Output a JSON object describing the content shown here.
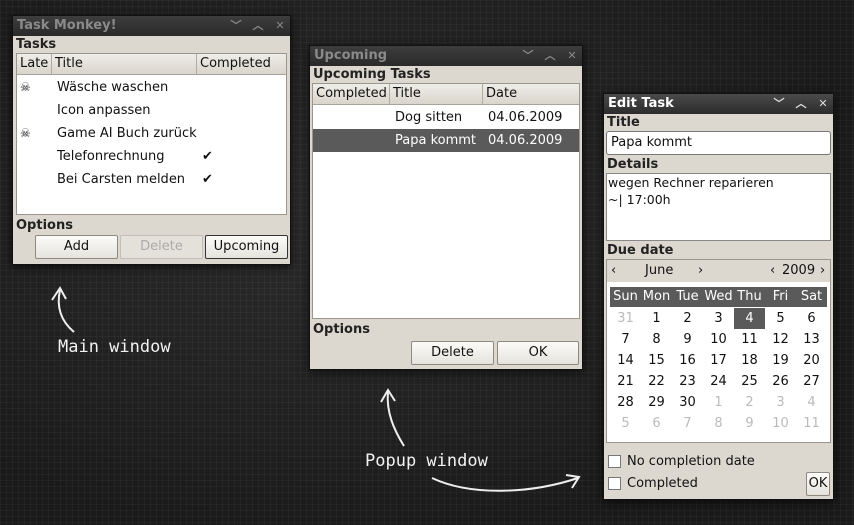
{
  "main": {
    "title": "Task Monkey!",
    "tasks_label": "Tasks",
    "columns": {
      "late": "Late",
      "title": "Title",
      "completed": "Completed"
    },
    "rows": [
      {
        "late": "☠",
        "title": "Wäsche waschen",
        "completed": ""
      },
      {
        "late": "",
        "title": "Icon anpassen",
        "completed": ""
      },
      {
        "late": "☠",
        "title": "Game AI Buch zurück",
        "completed": ""
      },
      {
        "late": "",
        "title": "Telefonrechnung",
        "completed": "✔"
      },
      {
        "late": "",
        "title": "Bei Carsten melden",
        "completed": "✔"
      }
    ],
    "options_label": "Options",
    "add": "Add",
    "delete": "Delete",
    "upcoming": "Upcoming"
  },
  "upcoming": {
    "title": "Upcoming",
    "section": "Upcoming Tasks",
    "columns": {
      "completed": "Completed",
      "title": "Title",
      "date": "Date"
    },
    "rows": [
      {
        "completed": "",
        "title": "Dog sitten",
        "date": "04.06.2009"
      },
      {
        "completed": "",
        "title": "Papa kommt",
        "date": "04.06.2009"
      }
    ],
    "options_label": "Options",
    "delete": "Delete",
    "ok": "OK"
  },
  "edit": {
    "title": "Edit Task",
    "title_label": "Title",
    "title_value": "Papa kommt",
    "details_label": "Details",
    "details_line1": "wegen Rechner reparieren",
    "details_line2": "~| 17:00h",
    "due_label": "Due date",
    "month": "June",
    "year": "2009",
    "weekdays": [
      "Sun",
      "Mon",
      "Tue",
      "Wed",
      "Thu",
      "Fri",
      "Sat"
    ],
    "days": [
      [
        "31",
        "1",
        "2",
        "3",
        "4",
        "5",
        "6"
      ],
      [
        "7",
        "8",
        "9",
        "10",
        "11",
        "12",
        "13"
      ],
      [
        "14",
        "15",
        "16",
        "17",
        "18",
        "19",
        "20"
      ],
      [
        "21",
        "22",
        "23",
        "24",
        "25",
        "26",
        "27"
      ],
      [
        "28",
        "29",
        "30",
        "1",
        "2",
        "3",
        "4"
      ],
      [
        "5",
        "6",
        "7",
        "8",
        "9",
        "10",
        "11"
      ]
    ],
    "no_completion": "No completion date",
    "completed": "Completed",
    "ok": "OK"
  },
  "annotations": {
    "main": "Main window",
    "popup": "Popup window"
  },
  "icons": {
    "minimize": "chevron-down-icon",
    "maximize": "chevron-up-icon",
    "close": "close-icon",
    "late": "skull-icon",
    "check": "checkmark-icon"
  }
}
